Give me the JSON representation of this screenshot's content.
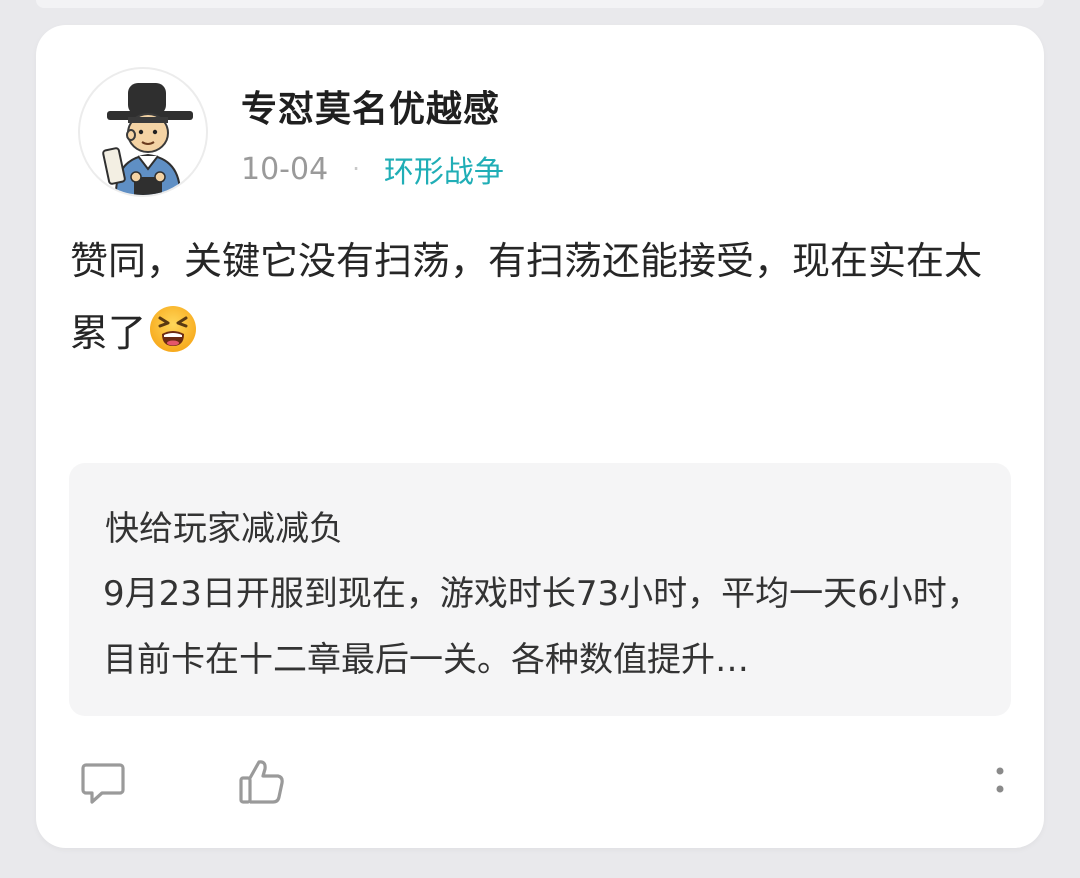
{
  "post": {
    "username": "专怼莫名优越感",
    "date": "10-04",
    "separator": "·",
    "topic": "环形战争",
    "content": "赞同，关键它没有扫荡，有扫荡还能接受，现在实在太累了",
    "emoji_icon": "tired-face-emoji-icon"
  },
  "quote": {
    "title": "快给玩家减减负",
    "body": "9月23日开服到现在，游戏时长73小时，平均一天6小时，目前卡在十二章最后一关。各种数值提升…"
  },
  "actions": {
    "comment_icon": "comment-icon",
    "like_icon": "thumbs-up-icon",
    "more_icon": "more-vertical-icon"
  },
  "colors": {
    "topic": "#20aeb6",
    "background": "#e9e9ec",
    "card": "#ffffff",
    "quote_bg": "#f5f5f6"
  }
}
